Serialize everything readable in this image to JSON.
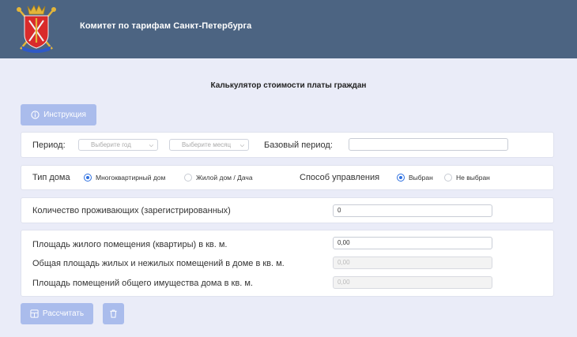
{
  "header": {
    "org_title": "Комитет по тарифам Санкт-Петербурга"
  },
  "page": {
    "title": "Калькулятор стоимости платы граждан"
  },
  "buttons": {
    "instruction": "Инструкция",
    "calculate": "Рассчитать"
  },
  "period": {
    "label": "Период:",
    "year_placeholder": "Выберите год",
    "month_placeholder": "Выберите месяц",
    "base_label": "Базовый период:",
    "base_value": ""
  },
  "house": {
    "type_label": "Тип дома",
    "type_options": [
      "Многоквартирный дом",
      "Жилой дом / Дача"
    ],
    "type_selected": "Многоквартирный дом",
    "mgmt_label": "Способ управления",
    "mgmt_options": [
      "Выбран",
      "Не выбран"
    ],
    "mgmt_selected": "Выбран"
  },
  "residents": {
    "label": "Количество проживающих (зарегистрированных)",
    "value": "0"
  },
  "area": {
    "living_label": "Площадь жилого помещения (квартиры) в кв. м.",
    "living_value": "0,00",
    "total_label": "Общая площадь жилых и нежилых помещений в доме в кв. м.",
    "total_value": "0,00",
    "common_label": "Площадь помещений общего имущества дома в кв. м.",
    "common_value": "0,00"
  },
  "colors": {
    "header_bg": "#4c6482",
    "button_bg": "#aabcec",
    "radio_accent": "#2d6fe0",
    "page_bg": "#eaecf8"
  }
}
